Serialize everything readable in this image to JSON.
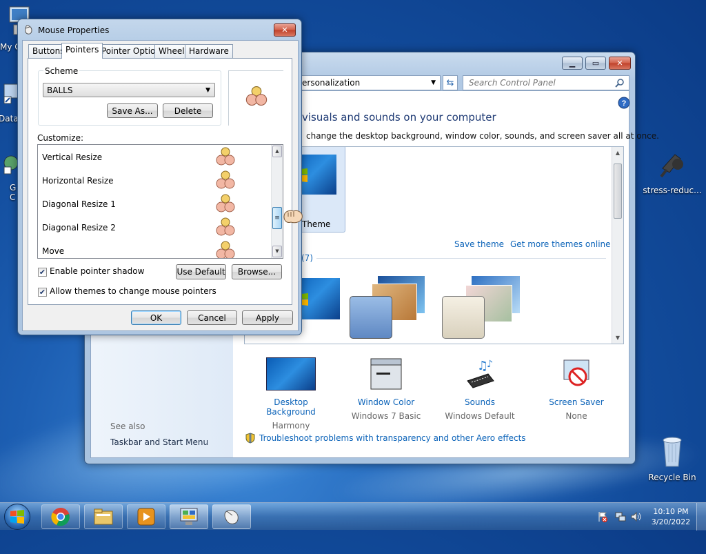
{
  "desktop": {
    "icons": [
      {
        "label": "My C"
      },
      {
        "label": "Data"
      },
      {
        "label": "G\nC"
      },
      {
        "label": "stress-reduc..."
      },
      {
        "label": "Recycle Bin"
      }
    ]
  },
  "control_panel": {
    "address": "ersonalization",
    "search_placeholder": "Search Control Panel",
    "heading": "visuals and sounds on your computer",
    "subheading": "change the desktop background, window color, sounds, and screen saver all at once.",
    "theme_label": "Theme",
    "save_theme": "Save theme",
    "get_more": "Get more themes online",
    "section_count": "(7)",
    "bottom_items": [
      {
        "title": "Desktop Background",
        "sub": "Harmony"
      },
      {
        "title": "Window Color",
        "sub": "Windows 7 Basic"
      },
      {
        "title": "Sounds",
        "sub": "Windows Default"
      },
      {
        "title": "Screen Saver",
        "sub": "None"
      }
    ],
    "see_also": "See also",
    "taskbar_link": "Taskbar and Start Menu",
    "troubleshoot": "Troubleshoot problems with transparency and other Aero effects"
  },
  "mouse_dialog": {
    "title": "Mouse Properties",
    "tabs": [
      "Buttons",
      "Pointers",
      "Pointer Options",
      "Wheel",
      "Hardware"
    ],
    "scheme_label": "Scheme",
    "scheme_value": "BALLS",
    "save_as": "Save As...",
    "delete": "Delete",
    "customize_label": "Customize:",
    "rows": [
      "Vertical Resize",
      "Horizontal Resize",
      "Diagonal Resize 1",
      "Diagonal Resize 2",
      "Move"
    ],
    "enable_shadow": "Enable pointer shadow",
    "use_default": "Use Default",
    "browse": "Browse...",
    "allow_themes": "Allow themes to change mouse pointers",
    "ok": "OK",
    "cancel": "Cancel",
    "apply": "Apply"
  },
  "taskbar": {
    "time": "10:10 PM",
    "date": "3/20/2022"
  },
  "colors": {
    "link": "#0d64b9",
    "accent": "#3c7fb1"
  }
}
